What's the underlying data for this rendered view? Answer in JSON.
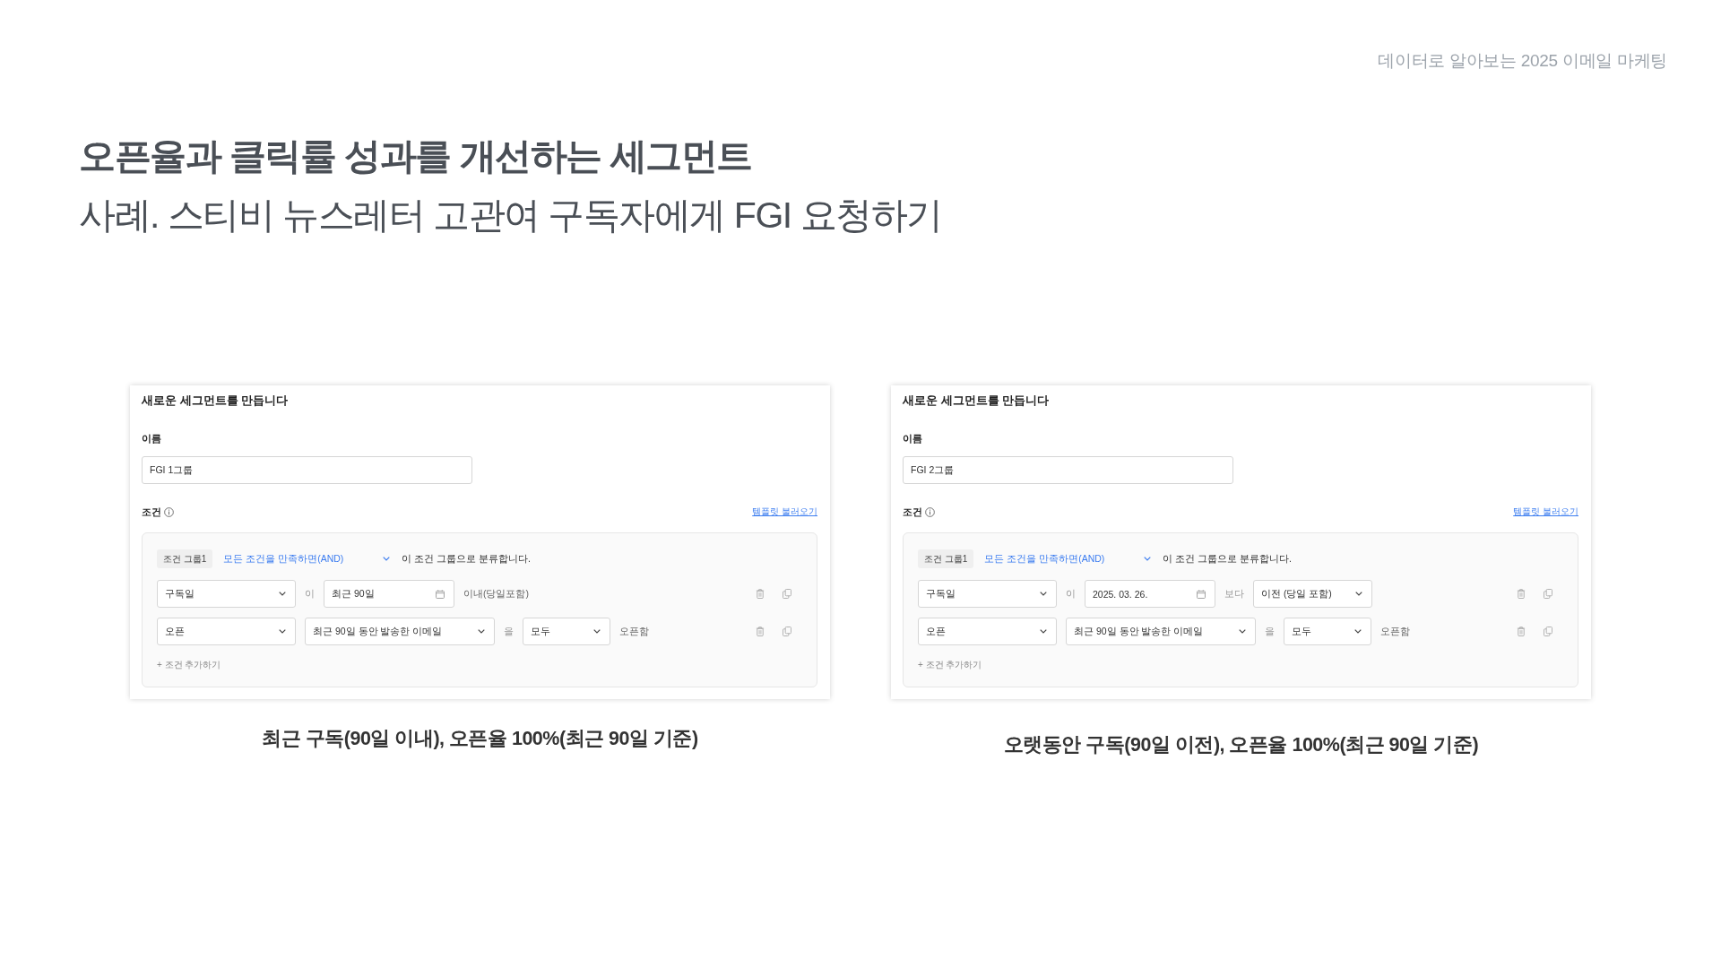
{
  "header": {
    "series_title": "데이터로 알아보는 2025 이메일 마케팅"
  },
  "title": "오픈율과 클릭률 성과를 개선하는 세그먼트",
  "subtitle": "사례. 스티비 뉴스레터 고관여 구독자에게 FGI 요청하기",
  "examples": [
    {
      "form": {
        "heading": "새로운 세그먼트를 만듭니다",
        "name_label": "이름",
        "name_value": "FGI 1그룹",
        "conditions_label": "조건",
        "template_link": "템플릿 불러오기",
        "group": {
          "tag": "조건 그룹1",
          "match_mode": "모든 조건을 만족하면(AND)",
          "description": "이 조건 그룹으로 분류합니다.",
          "conditions": [
            {
              "parts": [
                {
                  "kind": "select",
                  "text": "구독일"
                },
                {
                  "kind": "word",
                  "text": "이"
                },
                {
                  "kind": "date",
                  "text": "최근 90일"
                },
                {
                  "kind": "note",
                  "text": "이내(당일포함)"
                }
              ]
            },
            {
              "parts": [
                {
                  "kind": "select",
                  "text": "오픈"
                },
                {
                  "kind": "select",
                  "text": "최근 90일 동안 발송한 이메일"
                },
                {
                  "kind": "word",
                  "text": "을"
                },
                {
                  "kind": "select",
                  "text": "모두"
                },
                {
                  "kind": "note",
                  "text": "오픈함"
                }
              ]
            }
          ],
          "add_condition": "+ 조건 추가하기"
        }
      },
      "caption": "최근 구독(90일 이내), 오픈율 100%(최근 90일 기준)"
    },
    {
      "form": {
        "heading": "새로운 세그먼트를 만듭니다",
        "name_label": "이름",
        "name_value": "FGI 2그룹",
        "conditions_label": "조건",
        "template_link": "템플릿 불러오기",
        "group": {
          "tag": "조건 그룹1",
          "match_mode": "모든 조건을 만족하면(AND)",
          "description": "이 조건 그룹으로 분류합니다.",
          "conditions": [
            {
              "parts": [
                {
                  "kind": "select",
                  "text": "구독일"
                },
                {
                  "kind": "word",
                  "text": "이"
                },
                {
                  "kind": "date",
                  "text": "2025. 03. 26."
                },
                {
                  "kind": "word",
                  "text": "보다"
                },
                {
                  "kind": "select",
                  "text": "이전 (당일 포함)"
                }
              ]
            },
            {
              "parts": [
                {
                  "kind": "select",
                  "text": "오픈"
                },
                {
                  "kind": "select",
                  "text": "최근 90일 동안 발송한 이메일"
                },
                {
                  "kind": "word",
                  "text": "을"
                },
                {
                  "kind": "select",
                  "text": "모두"
                },
                {
                  "kind": "note",
                  "text": "오픈함"
                }
              ]
            }
          ],
          "add_condition": "+ 조건 추가하기"
        }
      },
      "caption": "오랫동안 구독(90일 이전), 오픈율 100%(최근 90일 기준)"
    }
  ]
}
